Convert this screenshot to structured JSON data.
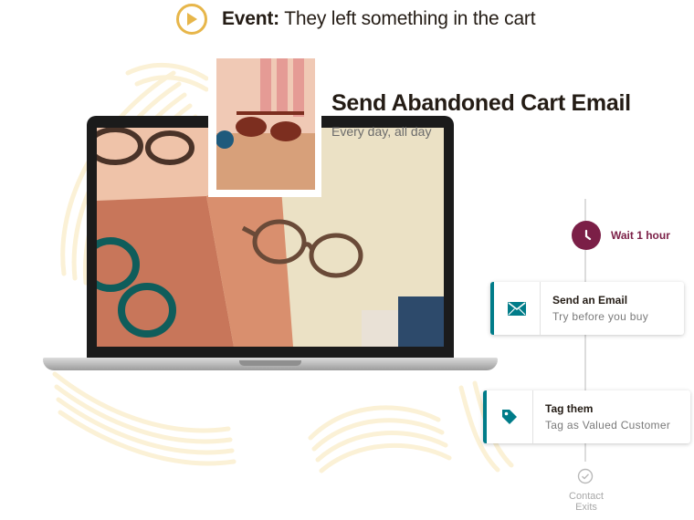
{
  "event": {
    "label": "Event:",
    "text": "They left something in the cart"
  },
  "campaign": {
    "title": "Send Abandoned Cart Email",
    "subtitle": "Every day, all day"
  },
  "workflow": {
    "wait_label": "Wait 1 hour",
    "steps": [
      {
        "title": "Send an Email",
        "subtitle": "Try before you buy",
        "icon": "envelope-icon"
      },
      {
        "title": "Tag them",
        "subtitle": "Tag as Valued Customer",
        "icon": "tag-icon"
      }
    ],
    "exit_label_line1": "Contact",
    "exit_label_line2": "Exits"
  },
  "colors": {
    "accent_gold": "#e7b64a",
    "wait_purple": "#7b1f47",
    "teal": "#007c89"
  }
}
